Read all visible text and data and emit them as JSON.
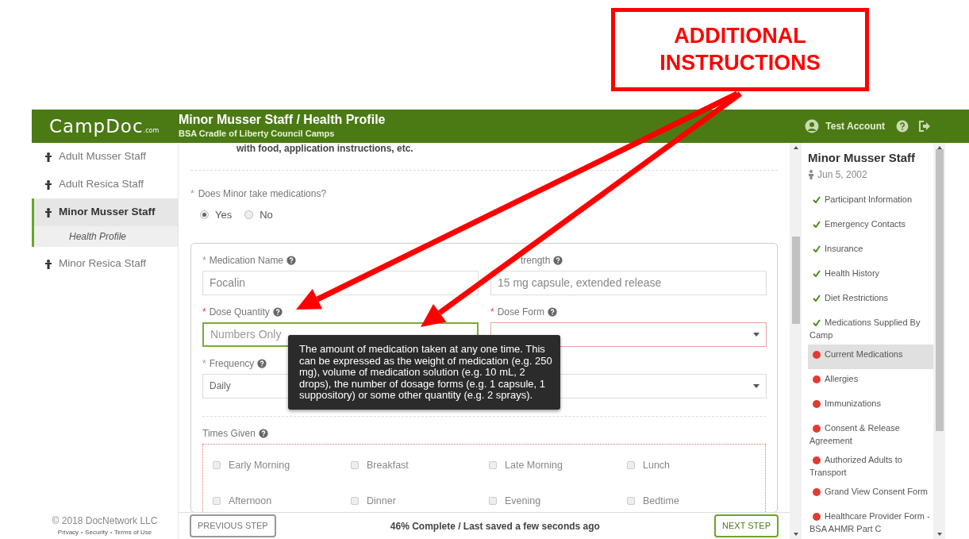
{
  "annotation": {
    "text": "ADDITIONAL INSTRUCTIONS"
  },
  "header": {
    "logo": "CampDoc",
    "logo_suffix": ".com",
    "title": "Minor Musser Staff / Health Profile",
    "subtitle": "BSA Cradle of Liberty Council Camps",
    "account": "Test Account"
  },
  "sidebar": {
    "items": [
      {
        "label": "Adult Musser Staff",
        "selected": false
      },
      {
        "label": "Adult Resica Staff",
        "selected": false
      },
      {
        "label": "Minor Musser Staff",
        "selected": true,
        "children": [
          {
            "label": "Health Profile"
          }
        ]
      },
      {
        "label": "Minor Resica Staff",
        "selected": false
      }
    ],
    "copyright": "© 2018 DocNetwork LLC",
    "links": [
      "Privacy",
      "Security",
      "Terms of Use"
    ]
  },
  "form": {
    "intro": "with food, application instructions, etc.",
    "question": {
      "mark": "*",
      "label": "Does Minor take medications?",
      "options": [
        {
          "label": "Yes",
          "selected": true
        },
        {
          "label": "No",
          "selected": false
        }
      ]
    },
    "fields": [
      {
        "kind": "text",
        "mark": "*",
        "label": "Medication Name",
        "value": "Focalin",
        "focused": false,
        "error": false
      },
      {
        "kind": "text",
        "label": "trength",
        "value": "15 mg capsule, extended release",
        "focused": false,
        "error": false
      },
      {
        "kind": "text",
        "mark": "*",
        "label": "Dose Quantity",
        "placeholder": "Numbers Only",
        "focused": true,
        "error": false
      },
      {
        "kind": "select",
        "mark": "*",
        "label": "Dose Form",
        "focused": false,
        "error": true
      },
      {
        "kind": "select",
        "mark": "*",
        "label": "Frequency",
        "value": "Daily",
        "focused": false,
        "error": false
      },
      {
        "kind": "select",
        "focused": false,
        "error": false
      }
    ],
    "times_given": {
      "label": "Times Given",
      "options": [
        {
          "label": "Early Morning",
          "checked": false
        },
        {
          "label": "Breakfast",
          "checked": false
        },
        {
          "label": "Late Morning",
          "checked": false
        },
        {
          "label": "Lunch",
          "checked": false
        },
        {
          "label": "Afternoon",
          "checked": false
        },
        {
          "label": "Dinner",
          "checked": false
        },
        {
          "label": "Evening",
          "checked": false
        },
        {
          "label": "Bedtime",
          "checked": false
        }
      ]
    }
  },
  "tooltip": {
    "text": "The amount of medication taken at any one time. This can be expressed as the weight of medication (e.g. 250 mg), volume of medication solution (e.g. 10 mL, 2 drops), the number of dosage forms (e.g. 1 capsule, 1 suppository) or some other quantity (e.g. 2 sprays)."
  },
  "bottom_bar": {
    "previous": "PREVIOUS STEP",
    "status": "46% Complete / Last saved a few seconds ago",
    "next": "NEXT STEP"
  },
  "profile": {
    "name": "Minor Musser Staff",
    "birthdate": "Jun 5, 2002",
    "steps": [
      {
        "label": "Participant Information",
        "complete": true,
        "selected": false
      },
      {
        "label": "Emergency Contacts",
        "complete": true,
        "selected": false
      },
      {
        "label": "Insurance",
        "complete": true,
        "selected": false
      },
      {
        "label": "Health History",
        "complete": true,
        "selected": false
      },
      {
        "label": "Diet Restrictions",
        "complete": true,
        "selected": false
      },
      {
        "label": "Medications Supplied By Camp",
        "complete": true,
        "selected": false
      },
      {
        "label": "Current Medications",
        "complete": false,
        "selected": true
      },
      {
        "label": "Allergies",
        "complete": false,
        "selected": false
      },
      {
        "label": "Immunizations",
        "complete": false,
        "selected": false
      },
      {
        "label": "Consent & Release Agreement",
        "complete": false,
        "selected": false
      },
      {
        "label": "Authorized Adults to Transport",
        "complete": false,
        "selected": false
      },
      {
        "label": "Grand View Consent Form",
        "complete": false,
        "selected": false
      },
      {
        "label": "Healthcare Provider Form - BSA AHMR Part C",
        "complete": false,
        "selected": false
      }
    ]
  }
}
